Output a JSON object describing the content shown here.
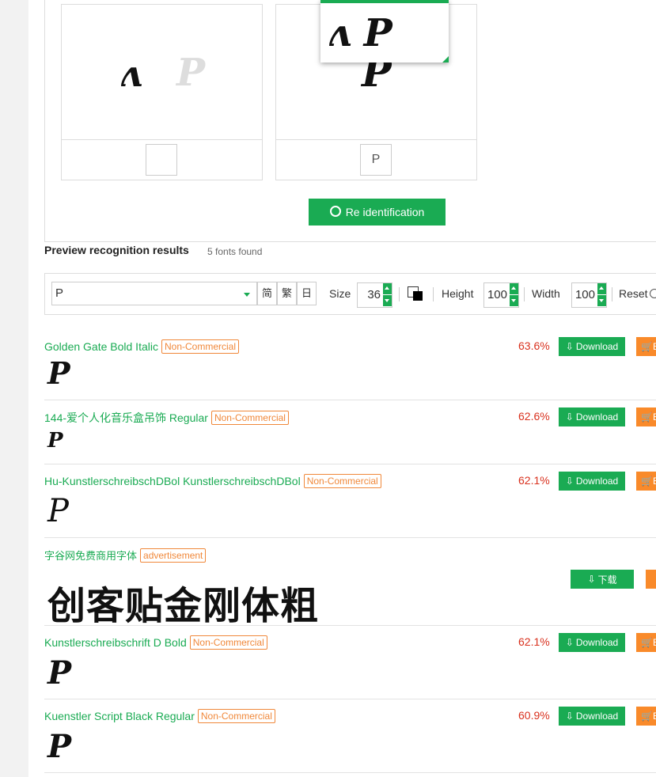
{
  "recognition": {
    "cards": [
      {
        "glyphs": "ʌ",
        "ghost": "P",
        "char": ""
      },
      {
        "glyphs": "P",
        "ghost": "",
        "char": "P"
      }
    ],
    "popup_glyphs": "ʌ P",
    "reid_label": "Re identification"
  },
  "results": {
    "title": "Preview recognition results",
    "count": "5 fonts found"
  },
  "toolbar": {
    "preview_text": "P",
    "seg_simplified": "简",
    "seg_traditional": "繁",
    "seg_japanese": "日",
    "size_label": "Size",
    "size_value": "36",
    "height_label": "Height",
    "height_value": "100",
    "width_label": "Width",
    "width_value": "100",
    "reset_label": "Reset"
  },
  "fonts": [
    {
      "name": "Golden Gate Bold Italic",
      "badge": "Non-Commercial",
      "score": "63.6%",
      "download": "Download",
      "buy": "B",
      "sample": "P"
    },
    {
      "name": "144-爱个人化音乐盒吊饰 Regular",
      "badge": "Non-Commercial",
      "score": "62.6%",
      "download": "Download",
      "buy": "B",
      "sample": "P"
    },
    {
      "name": "Hu-KunstlerschreibschDBol KunstlerschreibschDBol",
      "badge": "Non-Commercial",
      "score": "62.1%",
      "download": "Download",
      "buy": "B",
      "sample": "P"
    },
    {
      "name": "Kunstlerschreibschrift D Bold",
      "badge": "Non-Commercial",
      "score": "62.1%",
      "download": "Download",
      "buy": "B",
      "sample": "P"
    },
    {
      "name": "Kuenstler Script Black Regular",
      "badge": "Non-Commercial",
      "score": "60.9%",
      "download": "Download",
      "buy": "B",
      "sample": "P"
    }
  ],
  "ad": {
    "name": "字谷网免费商用字体",
    "badge": "advertisement",
    "download": "下载",
    "sample": "创客贴金刚体粗"
  },
  "colors": {
    "accent": "#1aab53",
    "score": "#d9311e",
    "badge": "#f0883a",
    "buy": "#f98a2a"
  }
}
